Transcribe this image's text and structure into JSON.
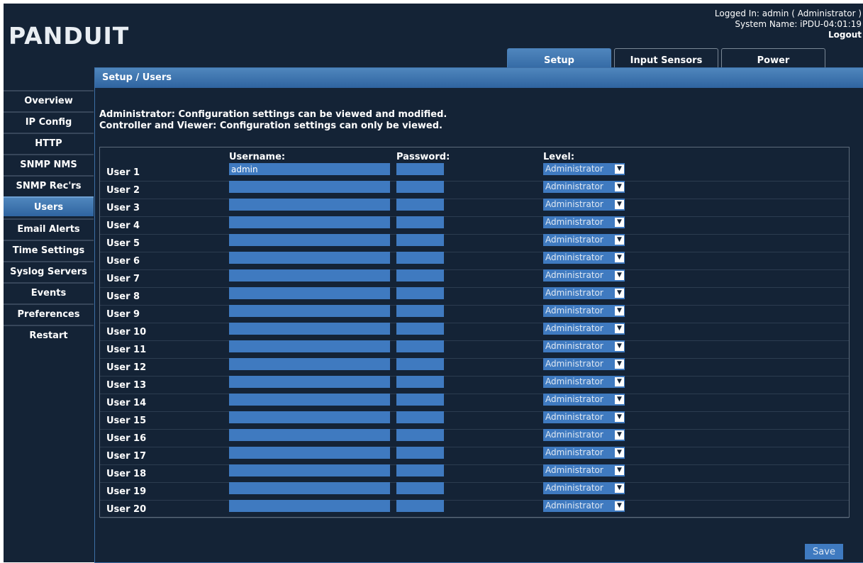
{
  "header": {
    "logo": "PANDUIT",
    "logged_in": "Logged In: admin ( Administrator )",
    "system_name": "System Name: iPDU-04:01:19",
    "logout": "Logout"
  },
  "tabs": [
    {
      "label": "Setup",
      "active": true
    },
    {
      "label": "Input Sensors",
      "active": false
    },
    {
      "label": "Power",
      "active": false
    }
  ],
  "sidebar": {
    "items": [
      {
        "label": "Overview"
      },
      {
        "label": "IP Config"
      },
      {
        "label": "HTTP"
      },
      {
        "label": "SNMP NMS"
      },
      {
        "label": "SNMP Rec'rs"
      },
      {
        "label": "Users",
        "active": true
      },
      {
        "label": "Email Alerts"
      },
      {
        "label": "Time Settings"
      },
      {
        "label": "Syslog Servers"
      },
      {
        "label": "Events"
      },
      {
        "label": "Preferences"
      },
      {
        "label": "Restart"
      }
    ]
  },
  "panel": {
    "title": "Setup / Users",
    "desc_line1": "Administrator: Configuration settings can be viewed and modified.",
    "desc_line2": "Controller and Viewer: Configuration settings can only be viewed."
  },
  "users_table": {
    "col_username": "Username:",
    "col_password": "Password:",
    "col_level": "Level:",
    "rows": [
      {
        "label": "User 1",
        "username": "admin",
        "level": "Administrator"
      },
      {
        "label": "User 2",
        "username": "",
        "level": "Administrator"
      },
      {
        "label": "User 3",
        "username": "",
        "level": "Administrator"
      },
      {
        "label": "User 4",
        "username": "",
        "level": "Administrator"
      },
      {
        "label": "User 5",
        "username": "",
        "level": "Administrator"
      },
      {
        "label": "User 6",
        "username": "",
        "level": "Administrator"
      },
      {
        "label": "User 7",
        "username": "",
        "level": "Administrator"
      },
      {
        "label": "User 8",
        "username": "",
        "level": "Administrator"
      },
      {
        "label": "User 9",
        "username": "",
        "level": "Administrator"
      },
      {
        "label": "User 10",
        "username": "",
        "level": "Administrator"
      },
      {
        "label": "User 11",
        "username": "",
        "level": "Administrator"
      },
      {
        "label": "User 12",
        "username": "",
        "level": "Administrator"
      },
      {
        "label": "User 13",
        "username": "",
        "level": "Administrator"
      },
      {
        "label": "User 14",
        "username": "",
        "level": "Administrator"
      },
      {
        "label": "User 15",
        "username": "",
        "level": "Administrator"
      },
      {
        "label": "User 16",
        "username": "",
        "level": "Administrator"
      },
      {
        "label": "User 17",
        "username": "",
        "level": "Administrator"
      },
      {
        "label": "User 18",
        "username": "",
        "level": "Administrator"
      },
      {
        "label": "User 19",
        "username": "",
        "level": "Administrator"
      },
      {
        "label": "User 20",
        "username": "",
        "level": "Administrator"
      }
    ]
  },
  "actions": {
    "save_label": "Save"
  },
  "colors": {
    "background": "#142336",
    "accent": "#3f7ac0",
    "active_tab": "#3a6fae"
  },
  "icons": {
    "dropdown": "caret-down-icon"
  }
}
